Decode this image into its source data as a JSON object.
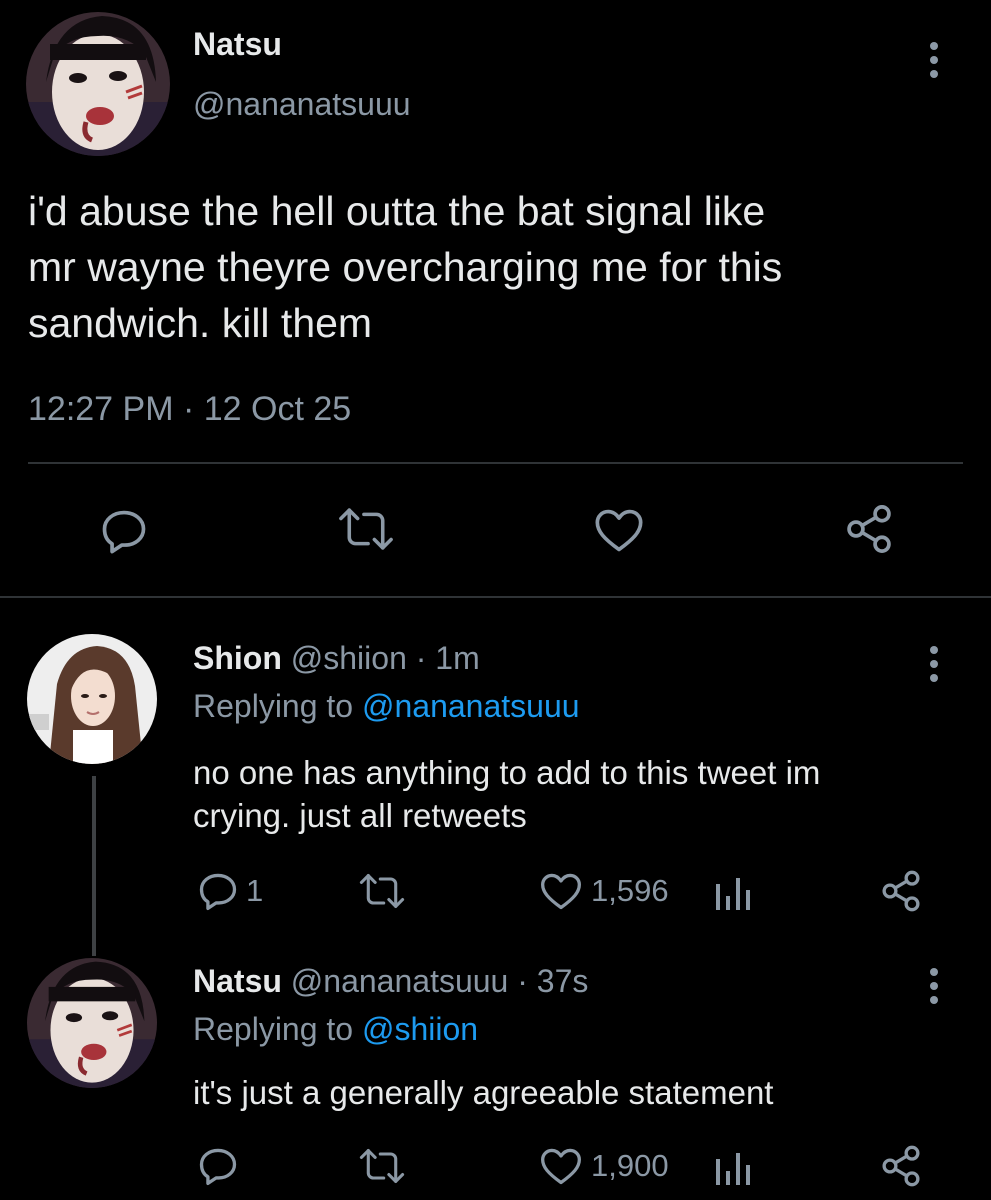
{
  "main_tweet": {
    "display_name": "Natsu",
    "handle": "@nananatsuuu",
    "text_lines": [
      "i'd abuse the hell outta the bat signal like",
      "mr wayne theyre overcharging me for this",
      "sandwich. kill them"
    ],
    "timestamp": "12:27 PM · 12 Oct 25",
    "actions": [
      "reply-icon",
      "retweet-icon",
      "like-icon",
      "share-icon"
    ]
  },
  "replies": [
    {
      "display_name": "Shion",
      "handle_meta": "@shiion · 1m",
      "replying_prefix": "Replying to ",
      "replying_handle": "@nananatsuuu",
      "text_lines": [
        "no one has anything to add to this tweet im",
        "crying. just all retweets"
      ],
      "reply_count": "1",
      "like_count": "1,596"
    },
    {
      "display_name": "Natsu",
      "handle_meta": "@nananatsuuu · 37s",
      "replying_prefix": "Replying to ",
      "replying_handle": "@shiion",
      "text_lines": [
        "it's just a generally agreeable statement"
      ],
      "reply_count": "",
      "like_count": "1,900"
    }
  ],
  "colors": {
    "background": "#000000",
    "text": "#e7e9ea",
    "secondary": "#8b98a5",
    "link": "#1d9bf0",
    "divider": "#2f3336"
  }
}
